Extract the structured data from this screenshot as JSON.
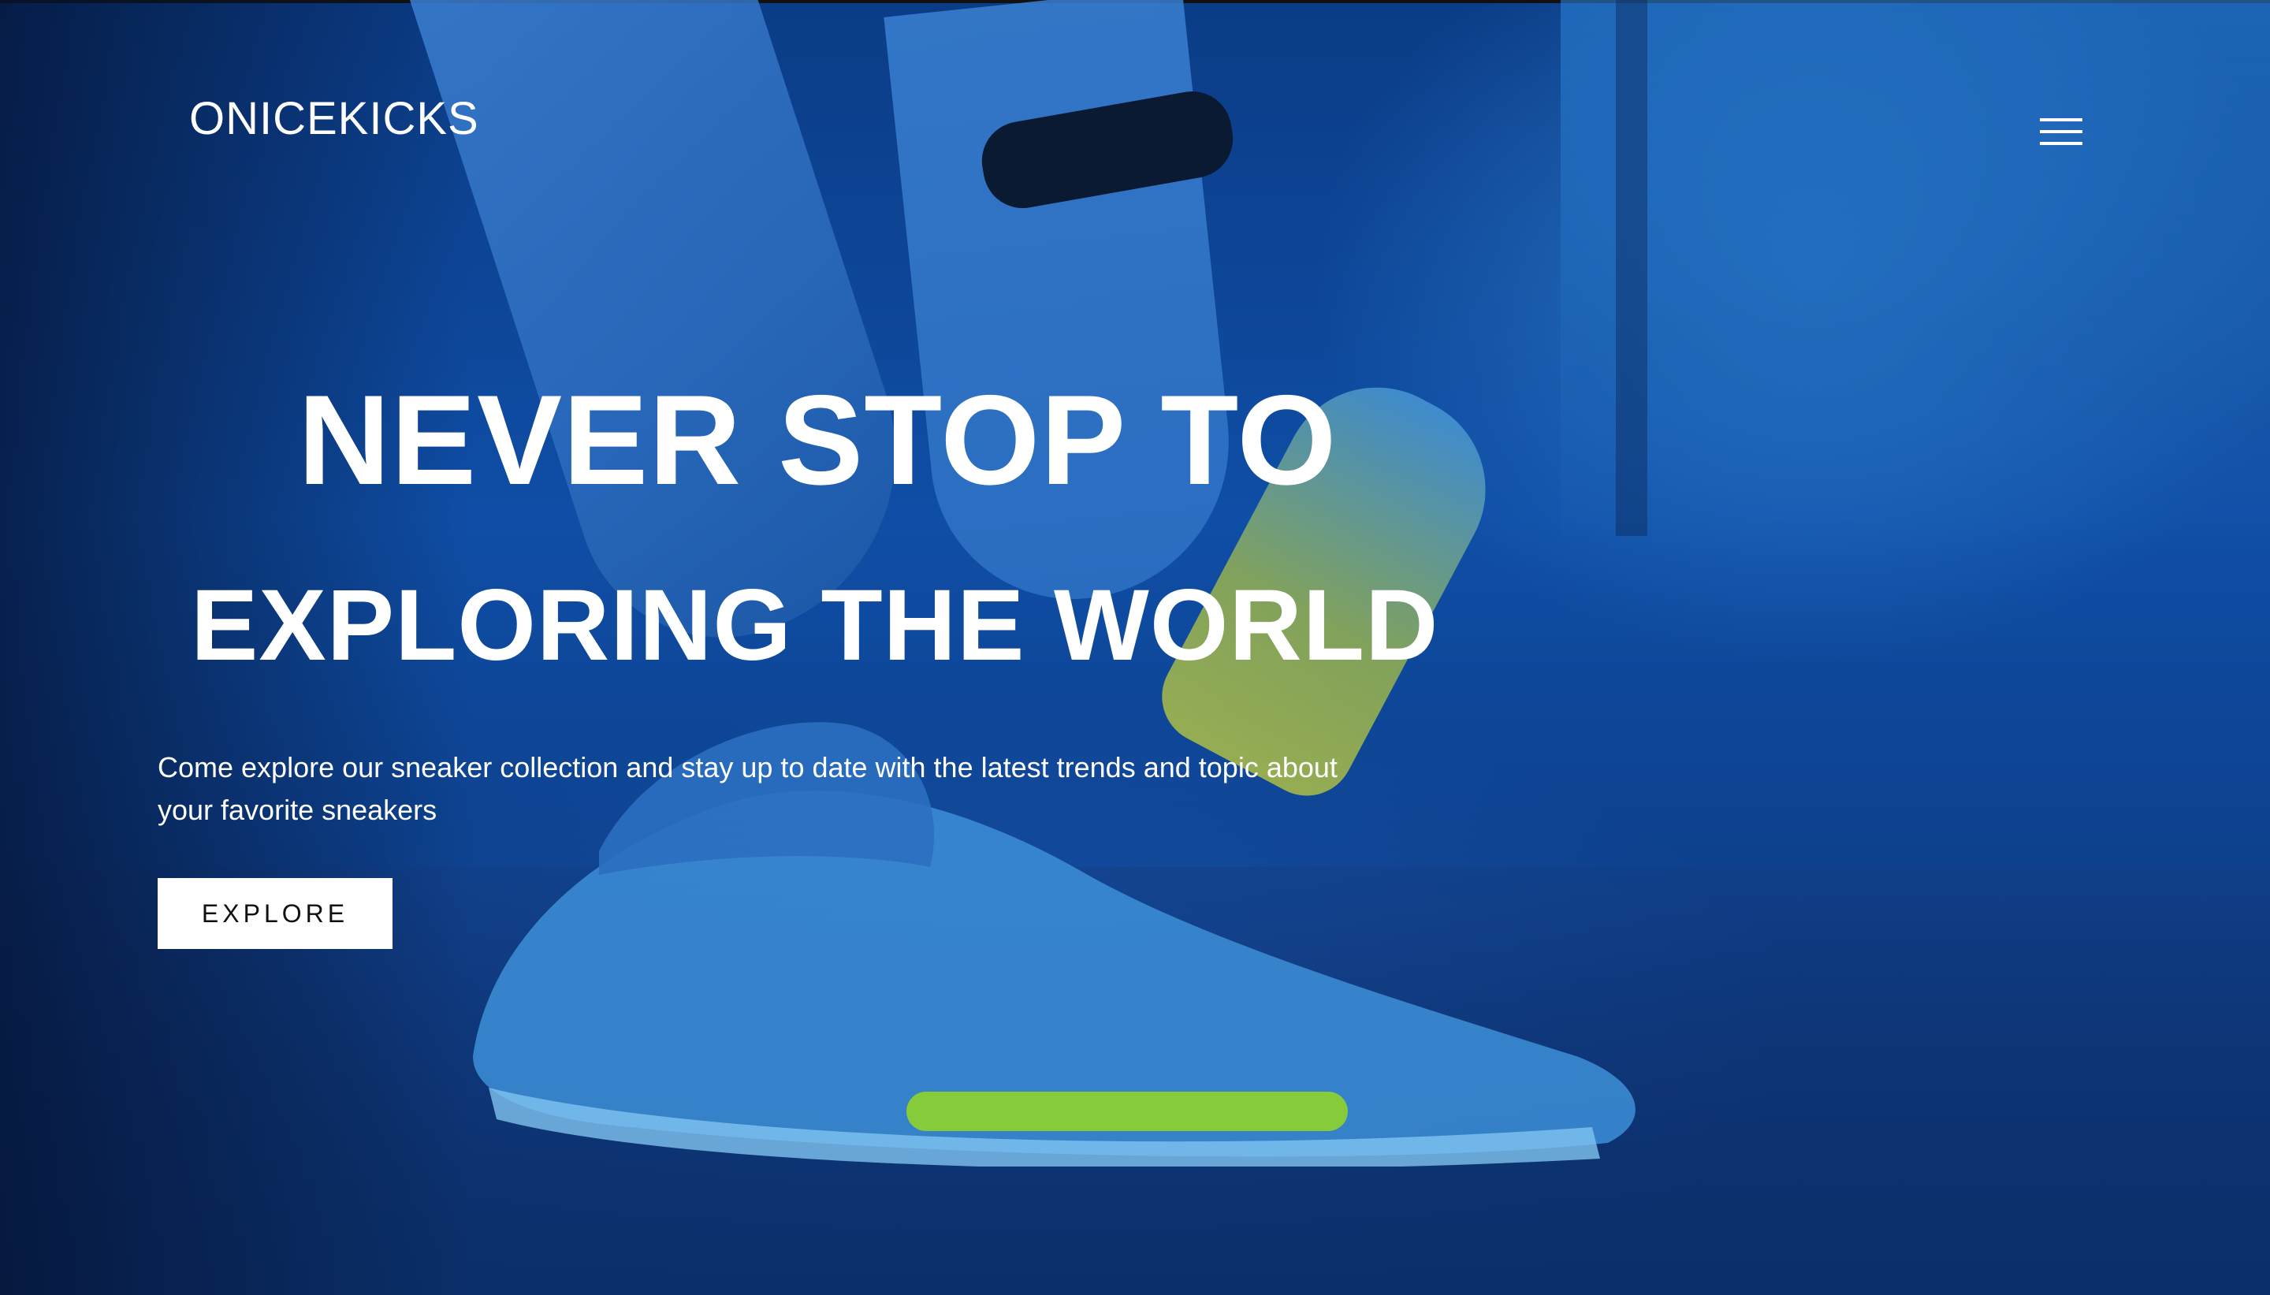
{
  "header": {
    "logo": "ONICEKICKS",
    "menu_icon": "hamburger-menu-icon"
  },
  "hero": {
    "headline_line1": "NEVER STOP TO",
    "headline_line2": "EXPLORING THE WORLD",
    "subtitle": "Come explore our sneaker collection and stay up to date with the latest trends and topic about your favorite sneakers",
    "cta_label": "EXPLORE",
    "background_image": "sneaker-lacing-photo"
  },
  "colors": {
    "text": "#ffffff",
    "button_bg": "#ffffff",
    "button_text": "#111111",
    "background_tint": "#0f4ea6"
  }
}
